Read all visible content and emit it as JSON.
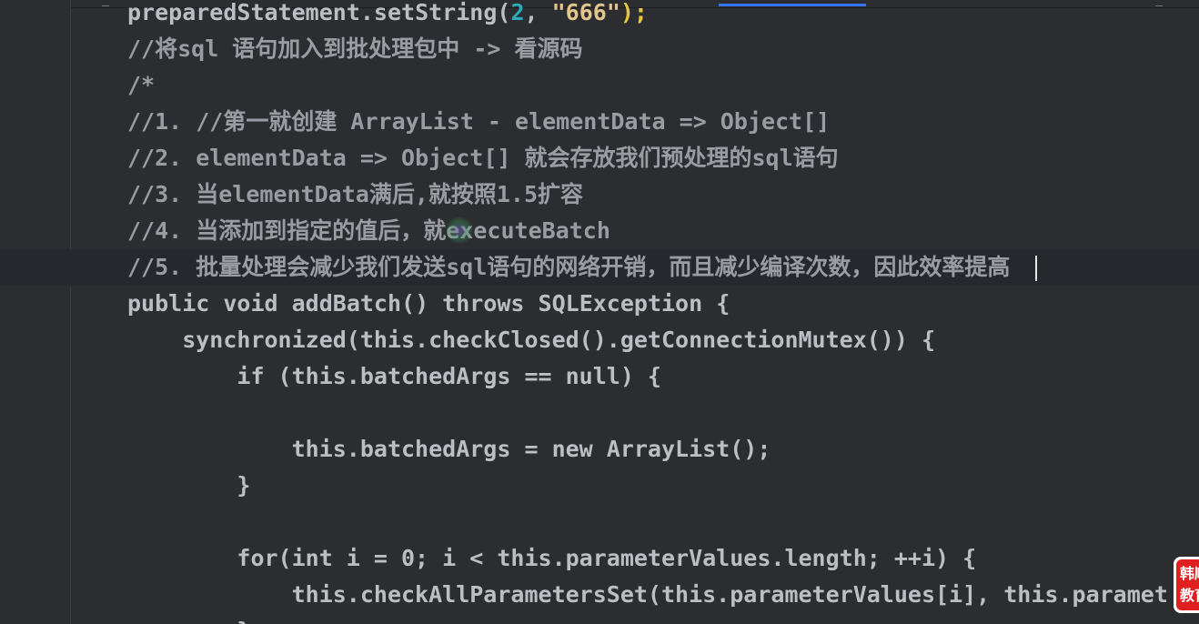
{
  "editor": {
    "lines": [
      {
        "indent": "",
        "parts": [
          {
            "t": "plain",
            "v": "preparedStatement.setString("
          },
          {
            "t": "number",
            "v": "2"
          },
          {
            "t": "plain",
            "v": ", "
          },
          {
            "t": "string",
            "v": "\"666\""
          },
          {
            "t": "paren-y",
            "v": ");"
          }
        ]
      },
      {
        "indent": "",
        "parts": [
          {
            "t": "comment",
            "v": "//将sql 语句加入到批处理包中 -> 看源码"
          }
        ]
      },
      {
        "indent": "",
        "parts": [
          {
            "t": "comment",
            "v": "/*"
          }
        ]
      },
      {
        "indent": "",
        "parts": [
          {
            "t": "comment",
            "v": "//1. //第一就创建 ArrayList - elementData => Object[]"
          }
        ]
      },
      {
        "indent": "",
        "parts": [
          {
            "t": "comment",
            "v": "//2. elementData => Object[] 就会存放我们预处理的sql语句"
          }
        ]
      },
      {
        "indent": "",
        "parts": [
          {
            "t": "comment",
            "v": "//3. 当elementData满后,就按照1.5扩容"
          }
        ]
      },
      {
        "indent": "",
        "parts": [
          {
            "t": "comment",
            "v": "//4. 当添加到指定的值后，就executeBatch"
          }
        ]
      },
      {
        "indent": "",
        "parts": [
          {
            "t": "comment",
            "v": "//5. 批量处理会减少我们发送sql语句的网络开销，而且减少编译次数，因此效率提高"
          }
        ]
      },
      {
        "indent": "",
        "parts": [
          {
            "t": "plain",
            "v": "public void addBatch() throws SQLException {"
          }
        ]
      },
      {
        "indent": "    ",
        "parts": [
          {
            "t": "plain",
            "v": "synchronized(this.checkClosed().getConnectionMutex()) {"
          }
        ]
      },
      {
        "indent": "        ",
        "parts": [
          {
            "t": "plain",
            "v": "if (this.batchedArgs == null) {"
          }
        ]
      },
      {
        "indent": "",
        "parts": [
          {
            "t": "plain",
            "v": ""
          }
        ]
      },
      {
        "indent": "            ",
        "parts": [
          {
            "t": "plain",
            "v": "this.batchedArgs = new ArrayList();"
          }
        ]
      },
      {
        "indent": "        ",
        "parts": [
          {
            "t": "plain",
            "v": "}"
          }
        ]
      },
      {
        "indent": "",
        "parts": [
          {
            "t": "plain",
            "v": ""
          }
        ]
      },
      {
        "indent": "        ",
        "parts": [
          {
            "t": "plain",
            "v": "for(int i = 0; i < this.parameterValues.length; ++i) {"
          }
        ]
      },
      {
        "indent": "            ",
        "parts": [
          {
            "t": "plain",
            "v": "this.checkAllParametersSet(this.parameterValues[i], this.paramet"
          }
        ]
      },
      {
        "indent": "        ",
        "parts": [
          {
            "t": "plain",
            "v": "}"
          }
        ]
      }
    ],
    "current_line_index": 7
  },
  "watermark": {
    "text": "韩顺\n教育"
  }
}
